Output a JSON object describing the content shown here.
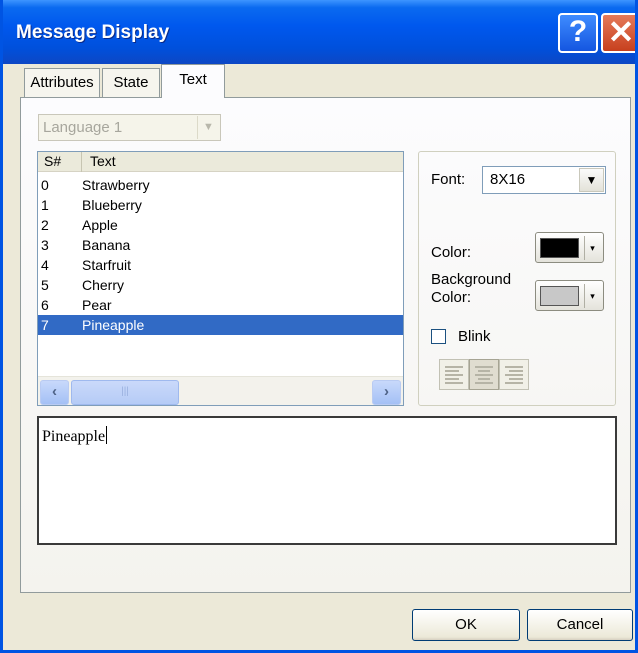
{
  "window": {
    "title": "Message Display"
  },
  "titlebar": {
    "help_glyph": "?",
    "close_glyph": "✕"
  },
  "tabs": [
    {
      "label": "Attributes",
      "active": false
    },
    {
      "label": "State",
      "active": false
    },
    {
      "label": "Text",
      "active": true
    }
  ],
  "language": {
    "selected": "Language 1"
  },
  "list": {
    "columns": [
      "S#",
      "Text"
    ],
    "rows": [
      {
        "sn": "0",
        "text": "Strawberry"
      },
      {
        "sn": "1",
        "text": "Blueberry"
      },
      {
        "sn": "2",
        "text": "Apple"
      },
      {
        "sn": "3",
        "text": "Banana"
      },
      {
        "sn": "4",
        "text": "Starfruit"
      },
      {
        "sn": "5",
        "text": "Cherry"
      },
      {
        "sn": "6",
        "text": "Pear"
      },
      {
        "sn": "7",
        "text": "Pineapple"
      }
    ],
    "selected_index": 7
  },
  "properties": {
    "font_label": "Font:",
    "font_value": "8X16",
    "color_label": "Color:",
    "color_value": "#000000",
    "background_label_line1": "Background",
    "background_label_line2": "Color:",
    "background_value": "#c8c8c8",
    "blink_label": "Blink",
    "blink_checked": false,
    "alignment": "center"
  },
  "message_text": "Pineapple",
  "buttons": {
    "ok": "OK",
    "cancel": "Cancel"
  },
  "colors": {
    "selection": "#316ac5",
    "title_bar": "#0054e3"
  }
}
